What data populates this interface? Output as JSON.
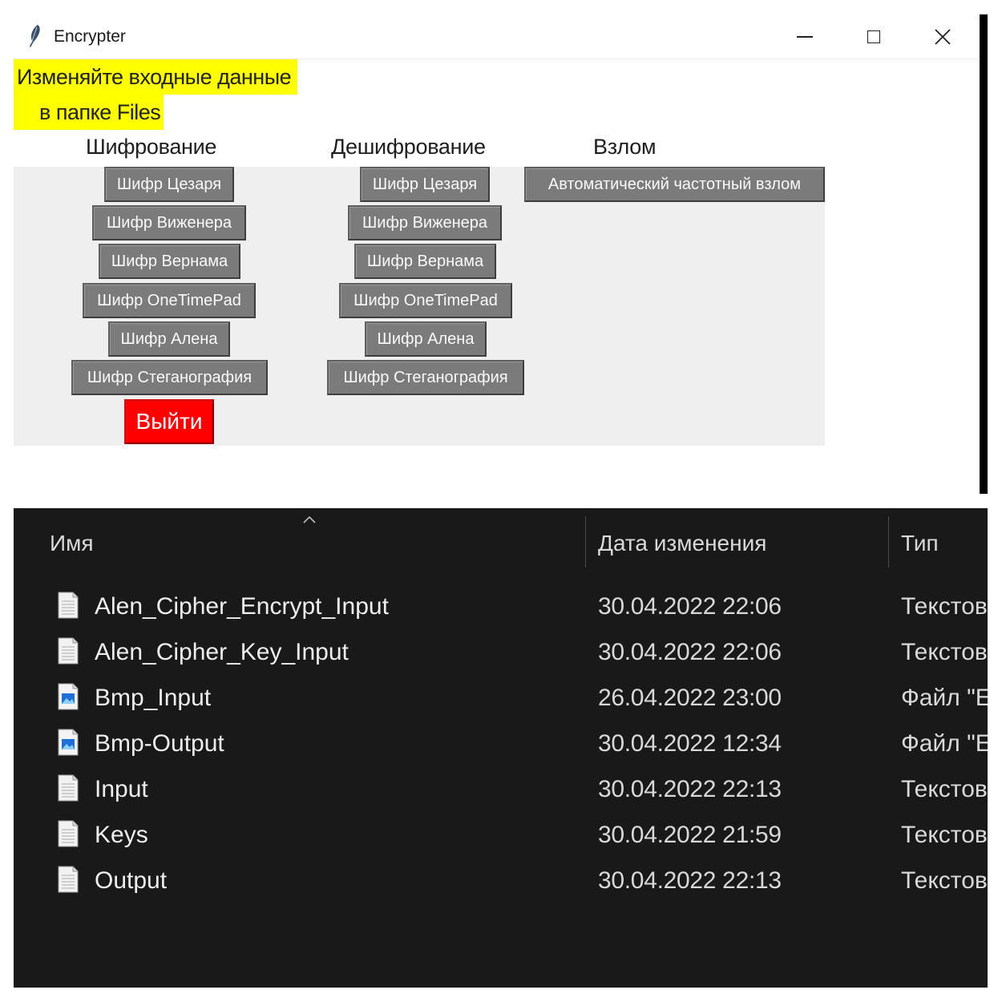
{
  "window": {
    "title": "Encrypter",
    "feather_icon": "tk-feather-icon"
  },
  "note": {
    "line1": "Изменяйте входные данные",
    "line2": "в папке Files",
    "highlight": "#ffff00"
  },
  "columns": {
    "encrypt": {
      "title": "Шифрование",
      "buttons": [
        "Шифр Цезаря",
        "Шифр Виженера",
        "Шифр Вернама",
        "Шифр OneTimePad",
        "Шифр Алена",
        "Шифр Стеганография"
      ]
    },
    "decrypt": {
      "title": "Дешифрование",
      "buttons": [
        "Шифр Цезаря",
        "Шифр Виженера",
        "Шифр Вернама",
        "Шифр OneTimePad",
        "Шифр Алена",
        "Шифр Стеганография"
      ]
    },
    "hack": {
      "title": "Взлом",
      "buttons": [
        "Автоматический частотный взлом"
      ]
    }
  },
  "exit_button": {
    "label": "Выйти",
    "color": "#ff0000"
  },
  "explorer": {
    "headers": {
      "name": "Имя",
      "date": "Дата изменения",
      "type": "Тип"
    },
    "files": [
      {
        "name": "Alen_Cipher_Encrypt_Input",
        "date": "30.04.2022 22:06",
        "type": "Текстов",
        "icon": "text-file-icon"
      },
      {
        "name": "Alen_Cipher_Key_Input",
        "date": "30.04.2022 22:06",
        "type": "Текстов",
        "icon": "text-file-icon"
      },
      {
        "name": "Bmp_Input",
        "date": "26.04.2022 23:00",
        "type": "Файл \"E",
        "icon": "image-file-icon"
      },
      {
        "name": "Bmp-Output",
        "date": "30.04.2022 12:34",
        "type": "Файл \"E",
        "icon": "image-file-icon"
      },
      {
        "name": "Input",
        "date": "30.04.2022 22:13",
        "type": "Текстов",
        "icon": "text-file-icon"
      },
      {
        "name": "Keys",
        "date": "30.04.2022 21:59",
        "type": "Текстов",
        "icon": "text-file-icon"
      },
      {
        "name": "Output",
        "date": "30.04.2022 22:13",
        "type": "Текстов",
        "icon": "text-file-icon"
      }
    ]
  }
}
